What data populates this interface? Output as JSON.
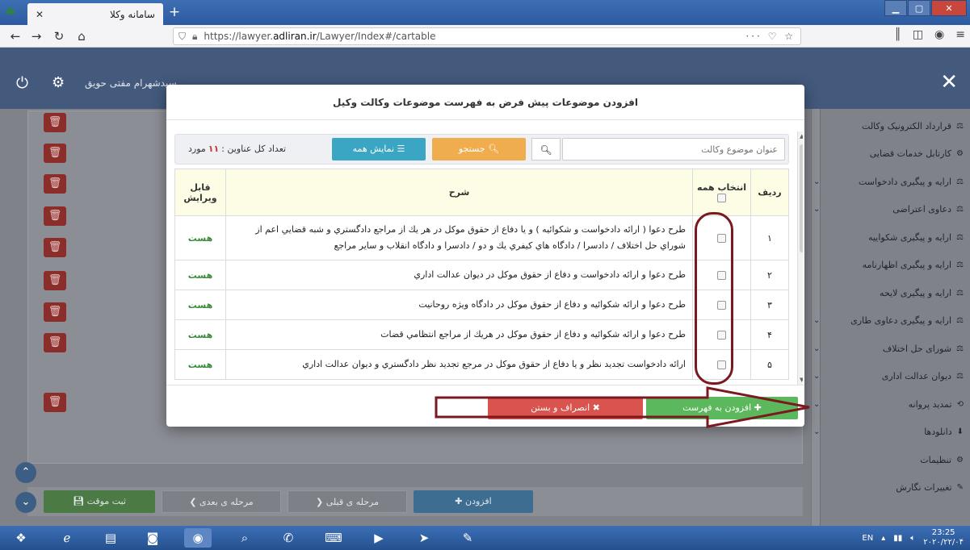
{
  "browser": {
    "tab_title": "سامانه وکلا",
    "tab_close": "✕",
    "new_tab": "+",
    "url_prefix": "https://lawyer.",
    "url_host": "adliran.ir",
    "url_path": "/Lawyer/Index#/cartable",
    "url_actions": "··· ♡ ☆"
  },
  "app": {
    "username": "سیدشهرام مفتی حویق"
  },
  "sidebar": {
    "items": [
      {
        "label": "قرارداد الکترونیک وکالت",
        "icon": "⚖",
        "has_arrow": false
      },
      {
        "label": "کارتابل خدمات قضایی",
        "icon": "⚙",
        "has_arrow": false
      },
      {
        "label": "ارایه و پیگیری دادخواست",
        "icon": "⚖",
        "has_arrow": true
      },
      {
        "label": "دعاوی اعتراضی",
        "icon": "⚖",
        "has_arrow": true
      },
      {
        "label": "ارایه و پیگیری شکواییه",
        "icon": "⚖",
        "has_arrow": false
      },
      {
        "label": "ارایه و پیگیری اظهارنامه",
        "icon": "⚖",
        "has_arrow": false
      },
      {
        "label": "ارایه و پیگیری لایحه",
        "icon": "⚖",
        "has_arrow": false
      },
      {
        "label": "ارایه و پیگیری دعاوی طاری",
        "icon": "⚖",
        "has_arrow": true
      },
      {
        "label": "شورای حل اختلاف",
        "icon": "⚖",
        "has_arrow": true
      },
      {
        "label": "دیوان عدالت اداری",
        "icon": "⚖",
        "has_arrow": true
      },
      {
        "label": "تمدید پروانه",
        "icon": "⟲",
        "has_arrow": true
      },
      {
        "label": "دانلودها",
        "icon": "⬇",
        "has_arrow": true
      },
      {
        "label": "تنظیمات",
        "icon": "⚙",
        "has_arrow": false
      },
      {
        "label": "تغییرات نگارش",
        "icon": "✎",
        "has_arrow": false
      }
    ]
  },
  "bottom_bar": {
    "submit": "ثبت موقت",
    "next": "مرحله ی بعدی",
    "prev": "مرحله ی قبلی",
    "add": "افزودن"
  },
  "modal": {
    "title": "افزودن موضوعات پیش فرض به فهرست موضوعات وکالت وکیل",
    "search_placeholder": "عنوان موضوع وکالت",
    "search_button": "جستجو",
    "show_all_button": "نمایش همه",
    "count_label": "تعداد کل عناوین :",
    "count_value": "۱۱",
    "count_unit": "مورد",
    "columns": {
      "row": "ردیف",
      "select_all": "انتخاب همه",
      "description": "شرح",
      "editable": "قابل ویرایش"
    },
    "rows": [
      {
        "num": "۱",
        "desc": "طرح دعوا ( ارائه دادخواست و شکوائیه ) و یا دفاع از حقوق موکل در هر یك از مراجع دادگستري و شبه قضایي اعم از شوراي حل اختلاف / دادسرا / دادگاه هاي کیفري یك و دو / دادسرا و دادگاه انقلاب و سایر مراجع",
        "editable": "هست"
      },
      {
        "num": "۲",
        "desc": "طرح دعوا و ارائه دادخواست و دفاع از حقوق موکل در دیوان عدالت اداري",
        "editable": "هست"
      },
      {
        "num": "۳",
        "desc": "طرح دعوا و ارائه شکوائیه و دفاع از حقوق موکل در دادگاه ویژه روحانیت",
        "editable": "هست"
      },
      {
        "num": "۴",
        "desc": "طرح دعوا و ارائه شکوائیه و دفاع از حقوق موکل در هریك از مراجع انتظامي قضات",
        "editable": "هست"
      },
      {
        "num": "۵",
        "desc": "ارائه دادخواست تجدید نظر و یا دفاع از حقوق موکل در مرجع تجدید نظر دادگستري و دیوان عدالت اداري",
        "editable": "هست"
      }
    ],
    "add_button": "افزودن به فهرست",
    "cancel_button": "انصراف و بستن"
  },
  "taskbar": {
    "lang": "EN",
    "time": "23:25",
    "date": "۲۰۲۰/۲۲/۰۴"
  },
  "colors": {
    "highlight": "#7a1a20",
    "add_green": "#5cb85c",
    "cancel_red": "#d9534f",
    "search_orange": "#f0ad4e",
    "showall_blue": "#3ba6c4",
    "editable_green": "#3c8a3c"
  }
}
